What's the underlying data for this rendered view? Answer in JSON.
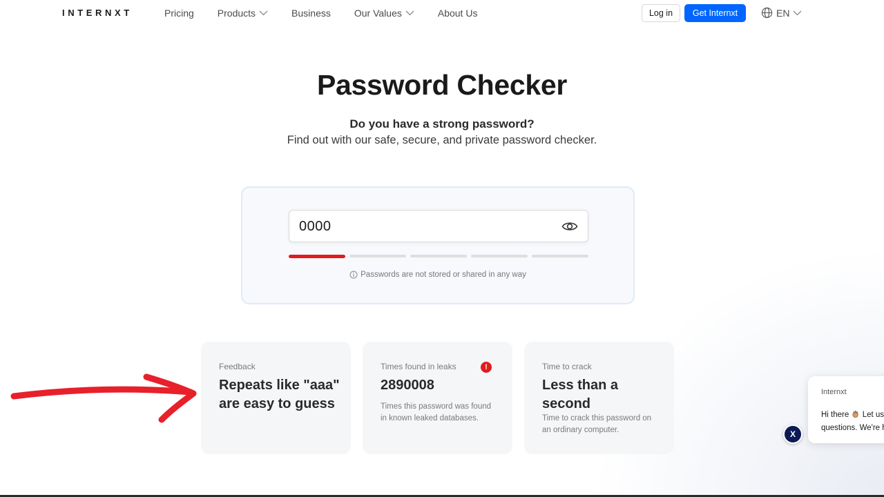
{
  "header": {
    "logo": "INTERNXT",
    "nav": [
      {
        "label": "Pricing",
        "dropdown": false
      },
      {
        "label": "Products",
        "dropdown": true
      },
      {
        "label": "Business",
        "dropdown": false
      },
      {
        "label": "Our Values",
        "dropdown": true
      },
      {
        "label": "About Us",
        "dropdown": false
      }
    ],
    "login_label": "Log in",
    "cta_label": "Get Internxt",
    "language": "EN"
  },
  "hero": {
    "title": "Password Checker",
    "subtitle_bold": "Do you have a strong password?",
    "subtitle": "Find out with our safe, secure, and private password checker."
  },
  "checker": {
    "password_value": "0000",
    "strength_segments": 5,
    "strength_level": 1,
    "note": "Passwords are not stored or shared in any way"
  },
  "cards": {
    "feedback": {
      "label": "Feedback",
      "value": "Repeats like \"aaa\" are easy to guess"
    },
    "leaks": {
      "label": "Times found in leaks",
      "value": "2890008",
      "description": "Times this password was found in known leaked databases.",
      "alert_symbol": "!"
    },
    "crack": {
      "label": "Time to crack",
      "value": "Less than a second",
      "description": "Time to crack this password on an ordinary computer."
    }
  },
  "chat": {
    "sender": "Internxt",
    "line1": "Hi there",
    "line1_rest": "Let us",
    "line2": "questions. We're h",
    "close_label": "X"
  },
  "colors": {
    "brand_blue": "#0066ff",
    "strength_red": "#e21b1b",
    "annotation_red": "#e8202a",
    "chat_close_navy": "#0b1a55"
  }
}
